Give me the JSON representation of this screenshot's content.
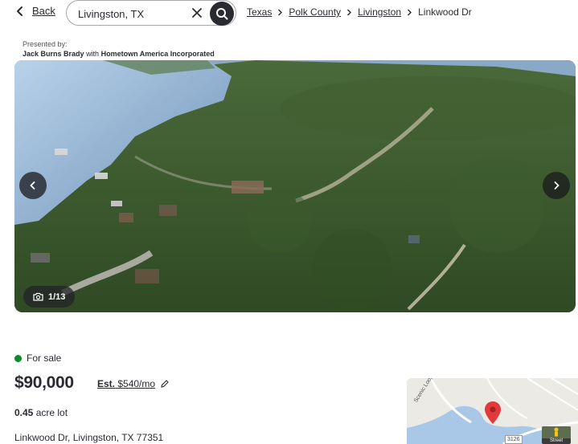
{
  "nav": {
    "back_label": "Back"
  },
  "search": {
    "value": "Livingston, TX"
  },
  "breadcrumb": {
    "items": [
      "Texas",
      "Polk County",
      "Livingston"
    ],
    "current": "Linkwood Dr"
  },
  "presenter": {
    "label": "Presented by:",
    "agent": "Jack Burns Brady",
    "connector": "with",
    "brokerage": "Hometown America Incorporated"
  },
  "gallery": {
    "counter": "1/13",
    "prev_icon": "chevron-left-icon",
    "next_icon": "chevron-right-icon",
    "camera_icon": "camera-icon"
  },
  "listing": {
    "status": "For sale",
    "status_color": "#0b8a2f",
    "price": "$90,000",
    "est_prefix": "Est.",
    "est_payment": "$540/mo",
    "lot_size": "0.45",
    "lot_unit": "acre lot",
    "address": "Linkwood Dr, Livingston, TX 77351"
  },
  "map": {
    "road_label": "Scenic Loop",
    "route_shield": "3126",
    "streetview_label": "Street"
  },
  "colors": {
    "text": "#2a2a33",
    "pin": "#e03a3a",
    "water": "#a9c8e8"
  }
}
